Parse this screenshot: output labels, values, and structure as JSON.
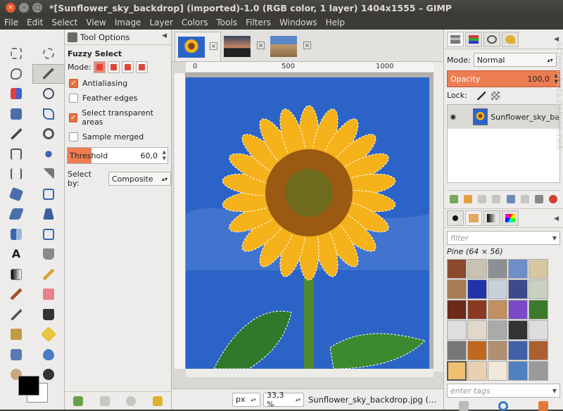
{
  "window": {
    "title": "*[Sunflower_sky_backdrop] (imported)-1.0 (RGB color, 1 layer) 1404x1555 – GIMP",
    "close": "×",
    "min": "–",
    "max": "□"
  },
  "menu": [
    "File",
    "Edit",
    "Select",
    "View",
    "Image",
    "Layer",
    "Colors",
    "Tools",
    "Filters",
    "Windows",
    "Help"
  ],
  "tool_options": {
    "tab_label": "Tool Options",
    "tool_name": "Fuzzy Select",
    "mode_label": "Mode:",
    "antialiasing": "Antialiasing",
    "feather_edges": "Feather edges",
    "select_transparent": "Select transparent areas",
    "sample_merged": "Sample merged",
    "threshold_label": "Threshold",
    "threshold_value": "60,0",
    "threshold_fraction": 0.24,
    "select_by_label": "Select by:",
    "select_by_value": "Composite"
  },
  "rulers": {
    "h": [
      "0",
      "500",
      "1000"
    ]
  },
  "status": {
    "unit": "px",
    "zoom": "33,3 %",
    "file": "Sunflower_sky_backdrop.jpg (…"
  },
  "layers": {
    "mode_label": "Mode:",
    "mode_value": "Normal",
    "opacity_label": "Opacity",
    "opacity_value": "100,0",
    "lock_label": "Lock:",
    "layer_name": "Sunflower_sky_ba"
  },
  "patterns": {
    "filter_placeholder": "filter",
    "current": "Pine (64 × 56)",
    "tags_placeholder": "enter tags"
  },
  "watermark": "screenshots.debian.net",
  "colors": {
    "accent": "#ec7d52",
    "sky": "#2b64c6",
    "petal": "#f5b21a"
  }
}
